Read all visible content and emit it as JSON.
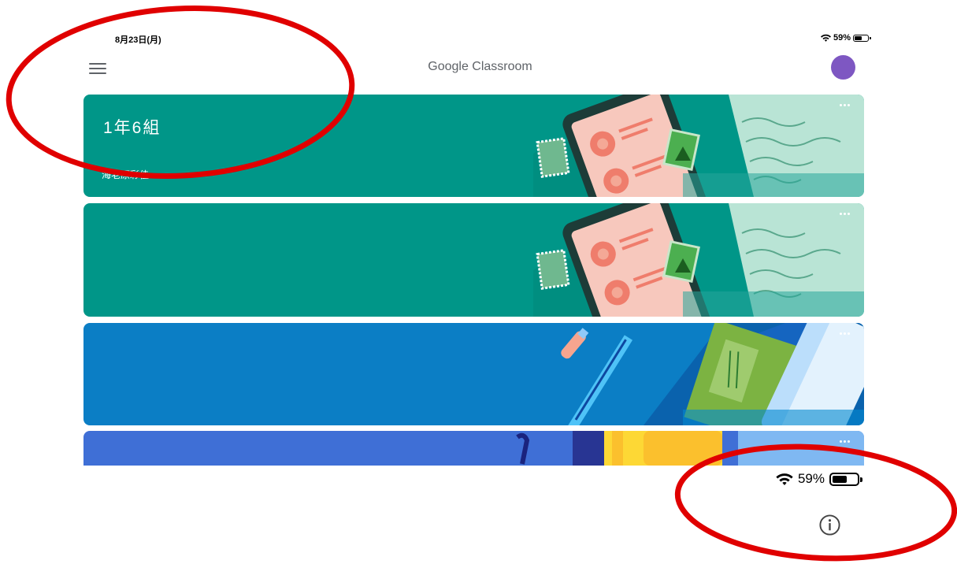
{
  "status_bar": {
    "time": "8月23日(月)",
    "battery": "59%",
    "battery_level": 0.59,
    "icons": [
      "wifi-icon",
      "battery-icon"
    ]
  },
  "app_bar": {
    "title": "Google Classroom",
    "menu_icon": "hamburger-menu-icon",
    "avatar_color": "#7e57c2"
  },
  "classes": [
    {
      "title": "1年6組",
      "subtitle": "海老原彩佳",
      "color": "#009688",
      "art": "phone-letters"
    },
    {
      "title": "",
      "subtitle": "",
      "color": "#009688",
      "art": "phone-letters"
    },
    {
      "title": "",
      "subtitle": "",
      "color": "#0b7ec5",
      "art": "books-pen"
    },
    {
      "title": "",
      "subtitle": "",
      "color": "#3f6fd6",
      "art": "notebook"
    }
  ],
  "bottom_overlay": {
    "battery": "59%",
    "battery_level": 0.59,
    "info_icon": "info-icon"
  },
  "annotation": {
    "shape": "ellipse",
    "color": "#e00000",
    "count": 2
  }
}
